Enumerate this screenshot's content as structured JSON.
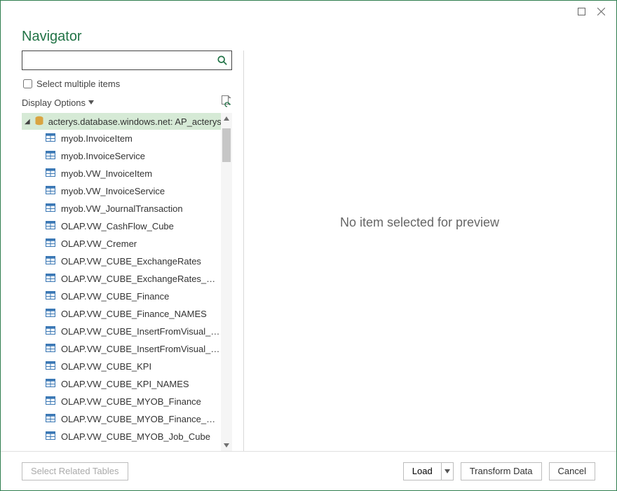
{
  "title": "Navigator",
  "search": {
    "placeholder": ""
  },
  "multi_items_label": "Select multiple items",
  "display_options_label": "Display Options",
  "root_label": "acterys.database.windows.net: AP_acterysd...",
  "tree_items": [
    "myob.InvoiceItem",
    "myob.InvoiceService",
    "myob.VW_InvoiceItem",
    "myob.VW_InvoiceService",
    "myob.VW_JournalTransaction",
    "OLAP.VW_CashFlow_Cube",
    "OLAP.VW_Cremer",
    "OLAP.VW_CUBE_ExchangeRates",
    "OLAP.VW_CUBE_ExchangeRates_NAMES",
    "OLAP.VW_CUBE_Finance",
    "OLAP.VW_CUBE_Finance_NAMES",
    "OLAP.VW_CUBE_InsertFromVisual_Cube",
    "OLAP.VW_CUBE_InsertFromVisual_Cube_...",
    "OLAP.VW_CUBE_KPI",
    "OLAP.VW_CUBE_KPI_NAMES",
    "OLAP.VW_CUBE_MYOB_Finance",
    "OLAP.VW_CUBE_MYOB_Finance_NAMES",
    "OLAP.VW_CUBE_MYOB_Job_Cube"
  ],
  "preview_empty_text": "No item selected for preview",
  "footer": {
    "select_related": "Select Related Tables",
    "load": "Load",
    "transform": "Transform Data",
    "cancel": "Cancel"
  }
}
